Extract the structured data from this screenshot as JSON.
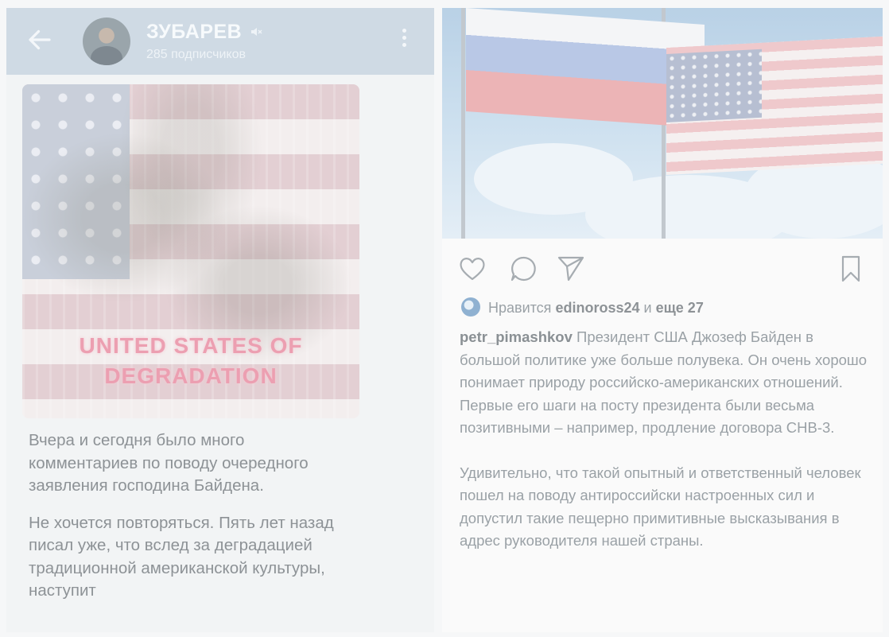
{
  "telegram": {
    "channel_name": "ЗУБАРЕВ",
    "subscribers": "285 подписчиков",
    "post_image_caption": "UNITED STATES OF DEGRADATION",
    "post_paragraphs": [
      "Вчера и сегодня было много комментариев по поводу очередного заявления господина Байдена.",
      "Не хочется повторяться. Пять лет назад писал уже, что вслед за деградацией традиционной американской культуры, наступит"
    ]
  },
  "instagram": {
    "likes_prefix": "Нравится",
    "likes_user": "edinoross24",
    "likes_and": "и",
    "likes_more": "еще 27",
    "author": "petr_pimashkov",
    "caption_first": "Президент США Джозеф Байден в большой политике уже больше полувека. Он очень хорошо понимает природу российско-американских отношений. Первые его шаги на посту президента были весьма позитивными – например, продление договора СНВ-3.",
    "caption_second": "Удивительно, что такой опытный и ответственный человек пошел на поводу антироссийски настроенных сил и допустил такие пещерно примитивные высказывания в адрес руководителя нашей страны."
  },
  "icons": {
    "back": "arrow-left-icon",
    "mute": "speaker-muted-icon",
    "menu": "kebab-menu-icon",
    "like": "heart-outline-icon",
    "comment": "speech-bubble-icon",
    "share": "paper-plane-icon",
    "save": "bookmark-outline-icon"
  },
  "colors": {
    "telegram_header": "#cfdae4",
    "caption_pink": "#ec9fb1",
    "text_gray": "#8d9296"
  }
}
